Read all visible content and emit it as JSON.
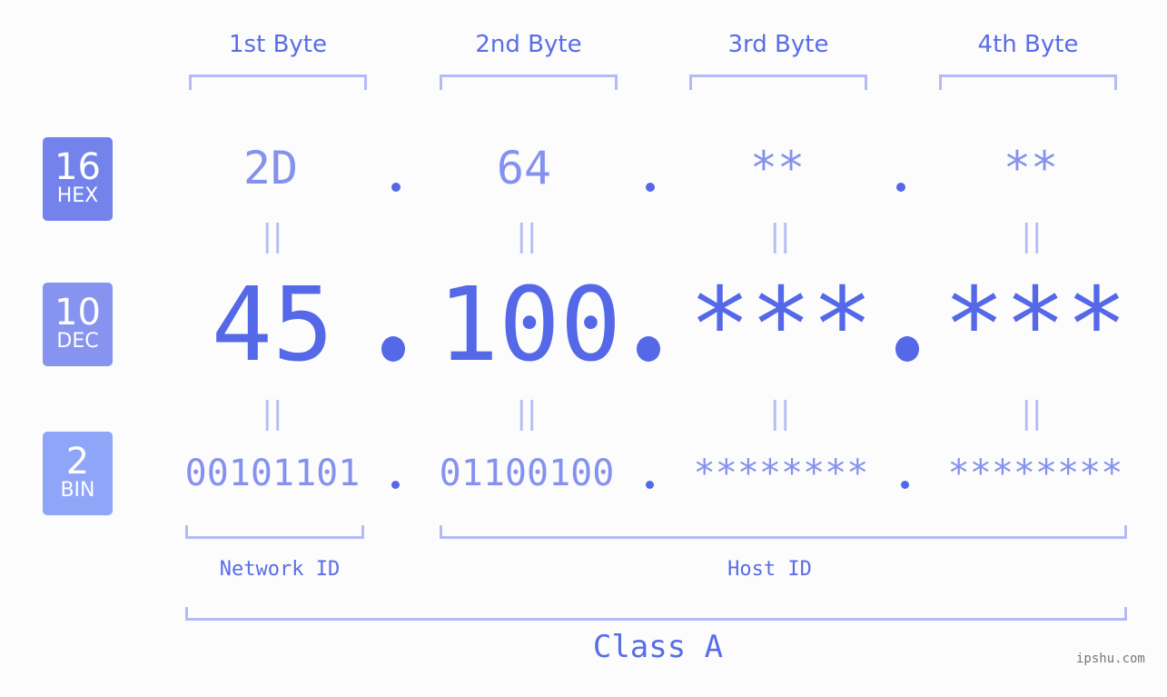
{
  "bytes": [
    {
      "label": "1st Byte",
      "hex": "2D",
      "dec": "45",
      "bin": "00101101"
    },
    {
      "label": "2nd Byte",
      "hex": "64",
      "dec": "100",
      "bin": "01100100"
    },
    {
      "label": "3rd Byte",
      "hex": "**",
      "dec": "***",
      "bin": "********"
    },
    {
      "label": "4th Byte",
      "hex": "**",
      "dec": "***",
      "bin": "********"
    }
  ],
  "badges": {
    "hex": {
      "num": "16",
      "label": "HEX",
      "color": "#7483ec"
    },
    "dec": {
      "num": "10",
      "label": "DEC",
      "color": "#8694f0"
    },
    "bin": {
      "num": "2",
      "label": "BIN",
      "color": "#8fa5f8"
    }
  },
  "equals_symbol": "||",
  "segments": {
    "network": "Network ID",
    "host": "Host ID"
  },
  "class_label": "Class A",
  "watermark": "ipshu.com"
}
